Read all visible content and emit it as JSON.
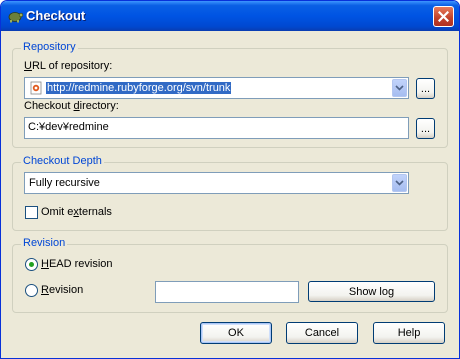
{
  "window": {
    "title": "Checkout",
    "close_icon": "close-icon"
  },
  "repository": {
    "legend": "Repository",
    "url_label_pre": "",
    "url_label_key": "U",
    "url_label_post": "RL of repository:",
    "url_value": "http://redmine.rubyforge.org/svn/trunk",
    "url_browse_label": "...",
    "dir_label_pre": "Checkout ",
    "dir_label_key": "d",
    "dir_label_post": "irectory:",
    "dir_value": "C:¥dev¥redmine",
    "dir_browse_label": "..."
  },
  "depth": {
    "legend": "Checkout Depth",
    "selected": "Fully recursive",
    "omit_label_pre": "Omit e",
    "omit_label_key": "x",
    "omit_label_post": "ternals",
    "omit_checked": false
  },
  "revision": {
    "legend": "Revision",
    "head_label_pre": "",
    "head_label_key": "H",
    "head_label_post": "EAD revision",
    "head_selected": true,
    "rev_label_pre": "",
    "rev_label_key": "R",
    "rev_label_post": "evision",
    "rev_value": "",
    "show_log_label": "Show log"
  },
  "footer": {
    "ok_label": "OK",
    "cancel_label": "Cancel",
    "help_label": "Help"
  }
}
